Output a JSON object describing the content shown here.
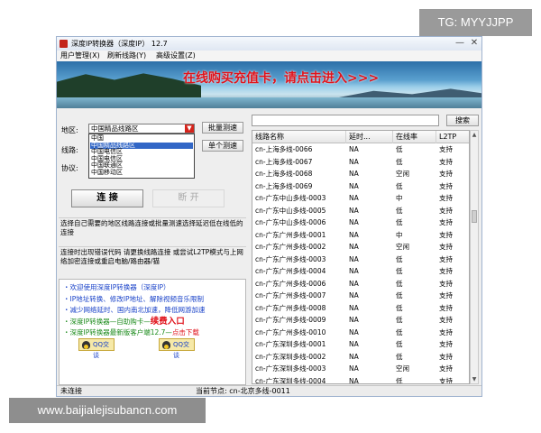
{
  "watermark_top": "TG: MYYJJPP",
  "watermark_bottom": "www.baijialejisubancn.com",
  "window": {
    "title": "深度IP转换器（深度IP） 12.7",
    "minimize_glyph": "—",
    "close_glyph": "✕"
  },
  "menu": {
    "user": "用户管理(X)",
    "refresh": "刷新线路(Y)",
    "advanced": "高级设置(Z)"
  },
  "banner": {
    "text": "在线购买充值卡，请点击进入>>>"
  },
  "form": {
    "region_label": "地区:",
    "line_label": "线路:",
    "protocol_label": "协议:",
    "region_selected": "中国精品线路区",
    "dropdown_arrow": "▼",
    "dropdown_options": [
      "中国",
      "中国精品线路区",
      "中国电信区",
      "中国电信区",
      "中国联通区",
      "中国移动区"
    ],
    "batch_test": "批量测速",
    "single_test": "单个测速",
    "connect": "连 接",
    "disconnect": "断 开"
  },
  "tips": {
    "tip1": "选择自己需要的地区线路连接或批量测速选择延迟低在线低的连接",
    "tip2": "连接时出现错误代码 请更换线路连接 或尝试L2TP模式与上网络加密连接或重启电脑/路由器/猫"
  },
  "ad": {
    "line1": "・欢迎使用深度IP转换器（深度IP）",
    "line2": "・IP地址转换、修改IP地址、解除视频音乐限制",
    "line3": "・减少网络延时、国内南北加速，降低网游加速",
    "line4_prefix": "・深度IP转换器—自助购卡—",
    "line4_buy": "续费入口",
    "line5_prefix": "・深度IP转换器最新版客户端12.7—",
    "line5_suffix": "点击下载",
    "qq1": "QQ交谈",
    "qq2": "QQ交谈"
  },
  "search": {
    "value": "",
    "button": "搜索"
  },
  "table": {
    "headers": [
      "线路名称",
      "延时...",
      "在线率",
      "L2TP"
    ],
    "rows": [
      [
        "cn-上海多线-0066",
        "NA",
        "低",
        "支持"
      ],
      [
        "cn-上海多线-0067",
        "NA",
        "低",
        "支持"
      ],
      [
        "cn-上海多线-0068",
        "NA",
        "空闲",
        "支持"
      ],
      [
        "cn-上海多线-0069",
        "NA",
        "低",
        "支持"
      ],
      [
        "cn-广东中山多线-0003",
        "NA",
        "中",
        "支持"
      ],
      [
        "cn-广东中山多线-0005",
        "NA",
        "低",
        "支持"
      ],
      [
        "cn-广东中山多线-0006",
        "NA",
        "低",
        "支持"
      ],
      [
        "cn-广东广州多线-0001",
        "NA",
        "中",
        "支持"
      ],
      [
        "cn-广东广州多线-0002",
        "NA",
        "空闲",
        "支持"
      ],
      [
        "cn-广东广州多线-0003",
        "NA",
        "低",
        "支持"
      ],
      [
        "cn-广东广州多线-0004",
        "NA",
        "低",
        "支持"
      ],
      [
        "cn-广东广州多线-0006",
        "NA",
        "低",
        "支持"
      ],
      [
        "cn-广东广州多线-0007",
        "NA",
        "低",
        "支持"
      ],
      [
        "cn-广东广州多线-0008",
        "NA",
        "低",
        "支持"
      ],
      [
        "cn-广东广州多线-0009",
        "NA",
        "低",
        "支持"
      ],
      [
        "cn-广东广州多线-0010",
        "NA",
        "低",
        "支持"
      ],
      [
        "cn-广东深圳多线-0001",
        "NA",
        "低",
        "支持"
      ],
      [
        "cn-广东深圳多线-0002",
        "NA",
        "低",
        "支持"
      ],
      [
        "cn-广东深圳多线-0003",
        "NA",
        "空闲",
        "支持"
      ],
      [
        "cn-广东深圳多线-0004",
        "NA",
        "低",
        "支持"
      ]
    ]
  },
  "scrollbar": {
    "up": "▲",
    "down": "▼"
  },
  "status": {
    "left": "未连接",
    "node": "当前节点: cn-北京多线-0011"
  }
}
